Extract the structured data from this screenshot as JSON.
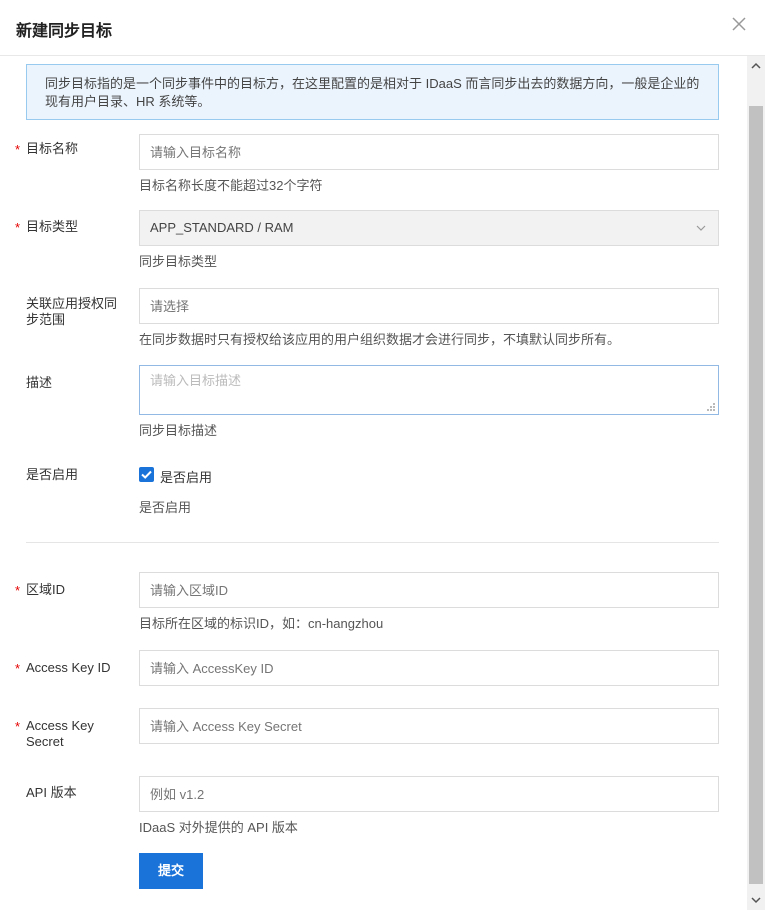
{
  "dialog": {
    "title": "新建同步目标"
  },
  "alert": {
    "text": "同步目标指的是一个同步事件中的目标方，在这里配置的是相对于 IDaaS 而言同步出去的数据方向，一般是企业的现有用户目录、HR 系统等。"
  },
  "form": {
    "target_name": {
      "label": "目标名称",
      "required": true,
      "placeholder": "请输入目标名称",
      "help": "目标名称长度不能超过32个字符"
    },
    "target_type": {
      "label": "目标类型",
      "required": true,
      "value": "APP_STANDARD / RAM",
      "help": "同步目标类型"
    },
    "auth_scope": {
      "label": "关联应用授权同步范围",
      "required": false,
      "placeholder": "请选择",
      "help": "在同步数据时只有授权给该应用的用户组织数据才会进行同步，不填默认同步所有。"
    },
    "description": {
      "label": "描述",
      "required": false,
      "placeholder": "请输入目标描述",
      "help": "同步目标描述"
    },
    "enabled": {
      "label": "是否启用",
      "checkbox_label": "是否启用",
      "checked": true,
      "help": "是否启用"
    },
    "region_id": {
      "label": "区域ID",
      "required": true,
      "placeholder": "请输入区域ID",
      "help": "目标所在区域的标识ID，如：cn-hangzhou"
    },
    "access_key_id": {
      "label": "Access Key ID",
      "required": true,
      "placeholder": "请输入 AccessKey ID"
    },
    "access_key_secret": {
      "label": "Access Key Secret",
      "required": true,
      "placeholder": "请输入 Access Key Secret"
    },
    "api_version": {
      "label": "API 版本",
      "required": false,
      "placeholder": "例如 v1.2",
      "help": "IDaaS 对外提供的 API 版本"
    },
    "submit_label": "提交"
  },
  "icons": {
    "close": "close-icon",
    "select_arrow": "chevron-down-icon",
    "checkbox": "checkmark-icon"
  },
  "colors": {
    "primary": "#1a73d9",
    "required": "#e60000",
    "alert_bg": "#ebf4fd",
    "alert_border": "#98c9ef"
  }
}
